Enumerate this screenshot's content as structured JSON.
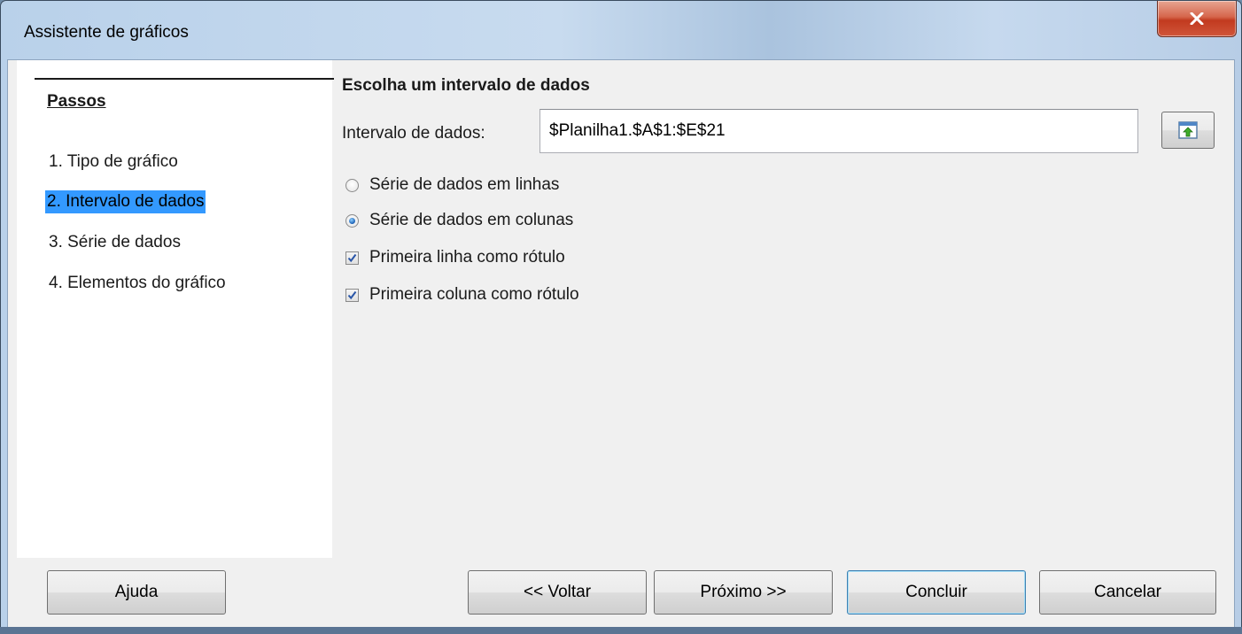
{
  "window": {
    "title": "Assistente de gráficos",
    "close_glyph": "x"
  },
  "steps": {
    "title": "Passos",
    "items": [
      {
        "label": "1. Tipo de gráfico",
        "active": false
      },
      {
        "label": "2. Intervalo de dados",
        "active": true
      },
      {
        "label": "3. Série de dados",
        "active": false
      },
      {
        "label": "4. Elementos do gráfico",
        "active": false
      }
    ]
  },
  "main": {
    "heading": "Escolha um intervalo de dados",
    "range_label": "Intervalo de dados:",
    "range_value": "$Planilha1.$A$1:$E$21",
    "shrink_icon": "select-range-icon",
    "options": [
      {
        "type": "radio",
        "label": "Série de dados em linhas",
        "checked": false
      },
      {
        "type": "radio",
        "label": "Série de dados em colunas",
        "checked": true
      },
      {
        "type": "checkbox",
        "label": "Primeira linha como rótulo",
        "checked": true
      },
      {
        "type": "checkbox",
        "label": "Primeira coluna como rótulo",
        "checked": true
      }
    ]
  },
  "buttons": {
    "help": "Ajuda",
    "back": "<< Voltar",
    "next": "Próximo >>",
    "finish": "Concluir",
    "cancel": "Cancelar"
  },
  "colors": {
    "selection": "#3399ff",
    "close_button": "#c8452a",
    "dialog_background": "#f0f0f0"
  }
}
